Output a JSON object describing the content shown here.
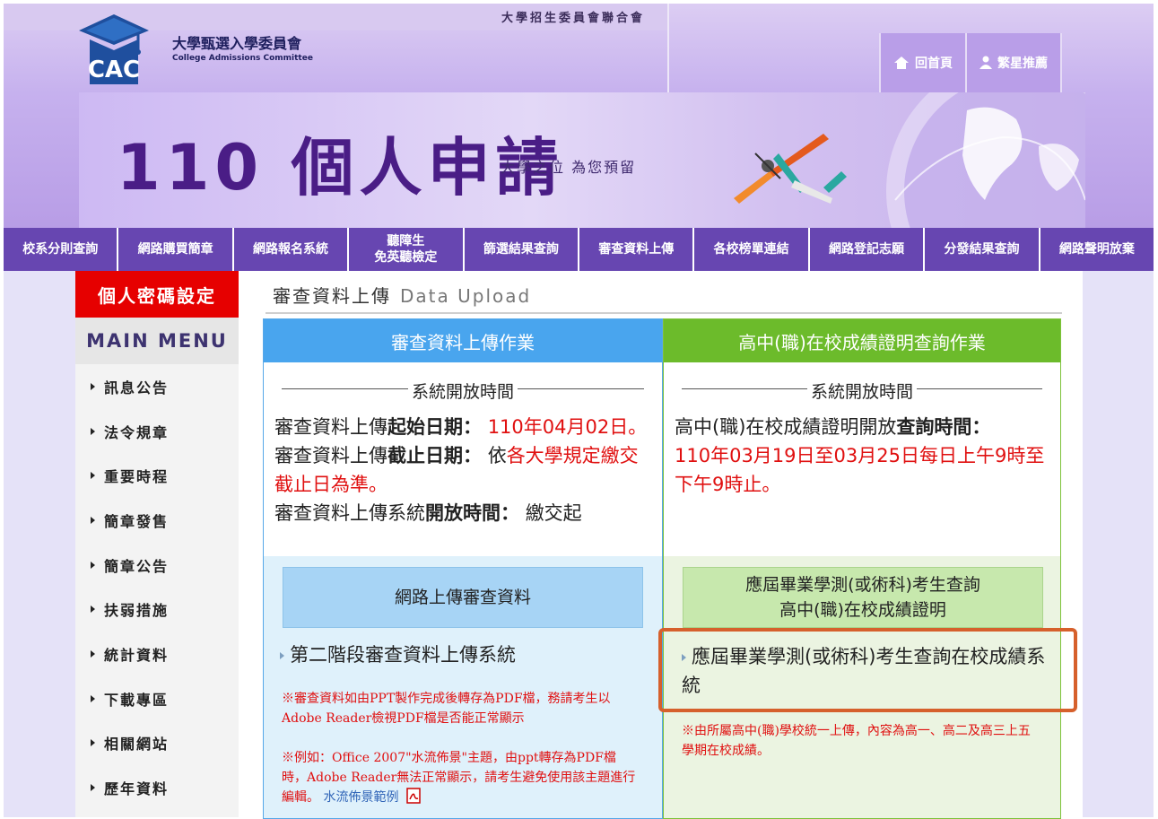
{
  "header": {
    "top_title": "大學招生委員會聯合會",
    "org_name_zh": "大學甄選入學委員會",
    "org_name_en": "College Admissions Committee",
    "logo_text": "CAC",
    "links": [
      {
        "icon": "home-icon",
        "label": "回首頁"
      },
      {
        "icon": "user-icon",
        "label": "繁星推薦"
      }
    ],
    "banner": {
      "title": "110 個人申請",
      "slogan": "大學之位 為您預留"
    }
  },
  "nav": [
    {
      "label": "校系分則查詢"
    },
    {
      "label": "網路購買簡章"
    },
    {
      "label": "網路報名系統"
    },
    {
      "label": "聽障生",
      "label2": "免英聽檢定"
    },
    {
      "label": "篩選結果查詢"
    },
    {
      "label": "審查資料上傳"
    },
    {
      "label": "各校榜單連結"
    },
    {
      "label": "網路登記志願"
    },
    {
      "label": "分發結果查詢"
    },
    {
      "label": "網路聲明放棄"
    }
  ],
  "sidebar": {
    "password_button": "個人密碼設定",
    "menu_title": "MAIN MENU",
    "items": [
      "訊息公告",
      "法令規章",
      "重要時程",
      "簡章發售",
      "簡章公告",
      "扶弱措施",
      "統計資料",
      "下載專區",
      "相關網站",
      "歷年資料"
    ]
  },
  "main": {
    "title_zh": "審查資料上傳",
    "title_en": "Data Upload",
    "left": {
      "header": "審查資料上傳作業",
      "section": "系統開放時間",
      "start_label_a": "審查資料上傳",
      "start_label_b": "起始日期",
      "start_colon": "：",
      "start_value": "110年04月02日。",
      "end_label_a": "審查資料上傳",
      "end_label_b": "截止日期",
      "end_colon": "：",
      "end_prefix": "依",
      "end_value": "各大學規定繳交截止日為準。",
      "open_label_a": "審查資料上傳系統",
      "open_label_b": "開放時間",
      "open_colon": "：",
      "open_value": "繳交起",
      "button": "網路上傳審查資料",
      "link": "第二階段審查資料上傳系統",
      "note1": "※審查資料如由PPT製作完成後轉存為PDF檔，務請考生以Adobe Reader檢視PDF檔是否能正常顯示",
      "note2": "※例如：Office 2007\"水流佈景\"主題，由ppt轉存為PDF檔時，Adobe Reader無法正常顯示，請考生避免使用該主題進行編輯。",
      "sample_link": "水流佈景範例"
    },
    "right": {
      "header": "高中(職)在校成績證明查詢作業",
      "section": "系統開放時間",
      "query_label_a": "高中(職)在校成績證明開放",
      "query_label_b": "查詢時間",
      "query_colon": "：",
      "query_value": "110年03月19日至03月25日每日上午9時至下午9時止。",
      "button_line1": "應屆畢業學測(或術科)考生查詢",
      "button_line2": "高中(職)在校成績證明",
      "link": "應屆畢業學測(或術科)考生查詢在校成績系統",
      "note": "※由所屬高中(職)學校統一上傳，內容為高一、高二及高三上五學期在校成績。"
    }
  },
  "colors": {
    "nav_bg": "#6746b1",
    "password_red": "#e60000",
    "left_header": "#49a5ee",
    "right_header": "#6cbb2b",
    "emphasis_red": "#e01010",
    "highlight": "#d6602c"
  }
}
